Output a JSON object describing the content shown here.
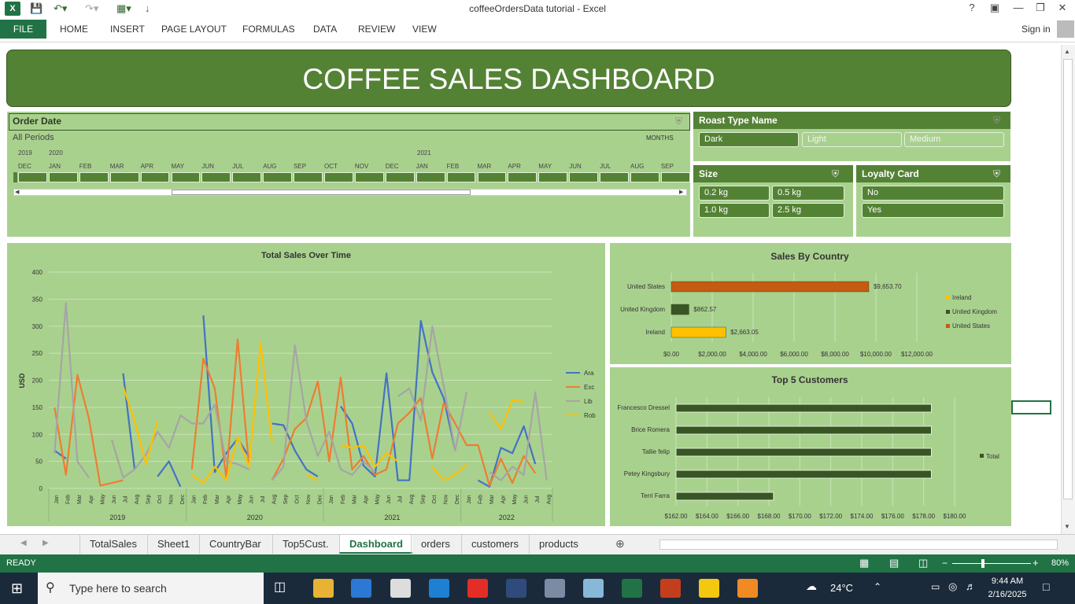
{
  "window": {
    "title": "coffeeOrdersData tutorial - Excel",
    "help": "?",
    "sign_in": "Sign in"
  },
  "ribbon": {
    "file": "FILE",
    "tabs": [
      "HOME",
      "INSERT",
      "PAGE LAYOUT",
      "FORMULAS",
      "DATA",
      "REVIEW",
      "VIEW"
    ]
  },
  "dashboard": {
    "title": "COFFEE SALES DASHBOARD"
  },
  "order_date": {
    "header": "Order Date",
    "all_periods": "All Periods",
    "unit": "MONTHS",
    "years": [
      "2019",
      "2020",
      "2021"
    ],
    "months": [
      "DEC",
      "JAN",
      "FEB",
      "MAR",
      "APR",
      "MAY",
      "JUN",
      "JUL",
      "AUG",
      "SEP",
      "OCT",
      "NOV",
      "DEC",
      "JAN",
      "FEB",
      "MAR",
      "APR",
      "MAY",
      "JUN",
      "JUL",
      "AUG",
      "SEP"
    ]
  },
  "roast": {
    "header": "Roast Type Name",
    "items": [
      "Dark",
      "Light",
      "Medium"
    ]
  },
  "size": {
    "header": "Size",
    "items": [
      "0.2 kg",
      "0.5 kg",
      "1.0 kg",
      "2.5 kg"
    ]
  },
  "loyalty": {
    "header": "Loyalty Card",
    "items": [
      "No",
      "Yes"
    ]
  },
  "colors": {
    "accent": "#548235",
    "panel": "#a9d18e",
    "ara": "#4472c4",
    "exc": "#ed7d31",
    "lib": "#a5a5a5",
    "rob": "#ffc000"
  },
  "chart_data": [
    {
      "type": "line",
      "title": "Total Sales Over Time",
      "ylabel": "USD",
      "ylim": [
        0,
        400
      ],
      "yticks": [
        "0",
        "50",
        "100",
        "150",
        "200",
        "250",
        "300",
        "350",
        "400"
      ],
      "x": [
        "Jan",
        "Feb",
        "Mar",
        "Apr",
        "May",
        "Jun",
        "Jul",
        "Aug",
        "Sep",
        "Oct",
        "Nov",
        "Dec",
        "Jan",
        "Feb",
        "Mar",
        "Apr",
        "May",
        "Jun",
        "Jul",
        "Aug",
        "Sep",
        "Oct",
        "Nov",
        "Dec",
        "Jan",
        "Feb",
        "Mar",
        "Apr",
        "May",
        "Jun",
        "Jul",
        "Aug",
        "Sep",
        "Oct",
        "Nov",
        "Dec",
        "Jan",
        "Feb",
        "Mar",
        "Apr",
        "May",
        "Jun",
        "Jul",
        "Aug"
      ],
      "year_labels": [
        "2019",
        "2020",
        "2021",
        "2022"
      ],
      "series": [
        {
          "name": "Ara",
          "values": [
            70,
            55,
            null,
            null,
            null,
            null,
            213,
            35,
            null,
            22,
            50,
            3,
            null,
            320,
            30,
            65,
            92,
            58,
            null,
            120,
            117,
            70,
            35,
            22,
            null,
            152,
            120,
            42,
            22,
            213,
            15,
            15,
            310,
            215,
            167,
            70,
            null,
            15,
            3,
            75,
            65,
            115,
            45,
            null
          ]
        },
        {
          "name": "Exc",
          "values": [
            150,
            25,
            210,
            130,
            5,
            10,
            15,
            null,
            null,
            null,
            null,
            null,
            35,
            240,
            185,
            20,
            276,
            40,
            null,
            15,
            55,
            110,
            130,
            198,
            50,
            205,
            35,
            60,
            25,
            35,
            120,
            140,
            167,
            55,
            158,
            120,
            80,
            80,
            5,
            55,
            10,
            60,
            28,
            null
          ]
        },
        {
          "name": "Lib",
          "values": [
            65,
            343,
            50,
            20,
            null,
            90,
            20,
            35,
            63,
            105,
            75,
            135,
            120,
            120,
            155,
            50,
            45,
            35,
            null,
            15,
            40,
            265,
            125,
            60,
            105,
            35,
            25,
            50,
            30,
            null,
            170,
            185,
            125,
            300,
            190,
            70,
            178,
            null,
            30,
            15,
            40,
            25,
            178,
            15
          ]
        },
        {
          "name": "Rob",
          "values": [
            null,
            null,
            null,
            null,
            null,
            null,
            188,
            125,
            45,
            125,
            null,
            null,
            25,
            10,
            40,
            15,
            95,
            40,
            270,
            85,
            null,
            null,
            25,
            15,
            null,
            80,
            75,
            80,
            40,
            65,
            50,
            null,
            null,
            40,
            15,
            25,
            45,
            null,
            140,
            110,
            163,
            160,
            null,
            null
          ]
        }
      ]
    },
    {
      "type": "bar",
      "title": "Sales By Country",
      "categories": [
        "United States",
        "United Kingdom",
        "Ireland"
      ],
      "values": [
        9653.7,
        862.57,
        2663.05
      ],
      "data_labels": [
        "$9,653.70",
        "$862.57",
        "$2,663.05"
      ],
      "colors": [
        "#c55a11",
        "#375623",
        "#ffc000"
      ],
      "xticks": [
        "$0.00",
        "$2,000.00",
        "$4,000.00",
        "$6,000.00",
        "$8,000.00",
        "$10,000.00",
        "$12,000.00"
      ],
      "xlim": [
        0,
        12000
      ],
      "legend": [
        "Ireland",
        "United Kingdom",
        "United States"
      ],
      "legend_position": "right"
    },
    {
      "type": "bar",
      "title": "Top 5 Customers",
      "categories": [
        "Francesco Dressel",
        "Brice Romera",
        "Tallie felip",
        "Petey Kingsbury",
        "Terri Farra"
      ],
      "values": [
        178.5,
        178.5,
        178.5,
        178.5,
        168.3
      ],
      "xticks": [
        "$162.00",
        "$164.00",
        "$166.00",
        "$168.00",
        "$170.00",
        "$172.00",
        "$174.00",
        "$176.00",
        "$178.00",
        "$180.00"
      ],
      "xlim": [
        162,
        180
      ],
      "legend": [
        "Total"
      ],
      "legend_position": "right"
    }
  ],
  "sheet_tabs": [
    "TotalSales",
    "Sheet1",
    "CountryBar",
    "Top5Cust.",
    "Dashboard",
    "orders",
    "customers",
    "products"
  ],
  "active_tab": "Dashboard",
  "status": {
    "ready": "READY",
    "zoom": "80%"
  },
  "taskbar": {
    "search_placeholder": "Type here to search",
    "weather": "24°C",
    "time": "9:44 AM",
    "date": "2/16/2025"
  }
}
